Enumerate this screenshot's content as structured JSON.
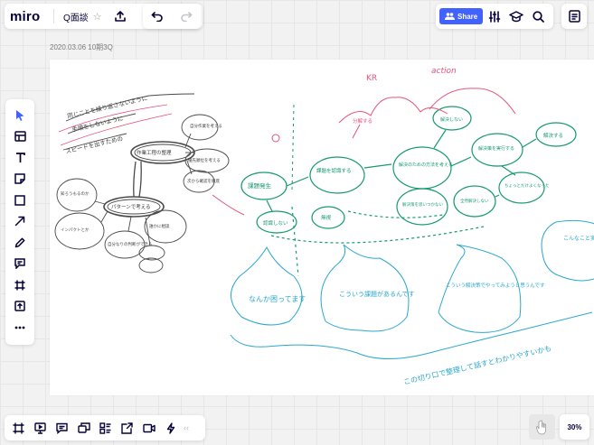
{
  "app": {
    "logo": "miro",
    "board_name": "Q面談",
    "zoom": "30%"
  },
  "header": {
    "share_label": "Share"
  },
  "frame": {
    "label": "2020.03.06 10期3Q"
  },
  "colors": {
    "accent": "#4262ff",
    "ink_black": "#333333",
    "ink_green": "#179a70",
    "ink_pink": "#e8527a",
    "ink_cyan": "#2aa8cf"
  },
  "board": {
    "black_notes": {
      "header_1": "同じことを繰り返さないように",
      "header_2": "手順をしないように",
      "header_3": "スピードを出すための"
    },
    "black_nodes": [
      "作業工程の整理",
      "自分作業を考える",
      "優先順位を考える",
      "次から確認を徹底",
      "知ろうもるのか",
      "パターンで考える",
      "インパクトとか",
      "自分なりの判断ができる",
      "誰かに相談"
    ],
    "green_nodes": [
      "課題発生",
      "認識しない",
      "課題を認識する",
      "無視",
      "解決のための方法を考える",
      "解決しない",
      "解決策を実行する",
      "解決する",
      "解決策を思いつかない",
      "全然解決しない",
      "ちょっとだけよくなった"
    ],
    "pink_labels": {
      "kr": "KR",
      "action": "action",
      "breakdown": "分解する"
    },
    "cyan_notes": {
      "bubble_1": "なんか困ってます",
      "bubble_2": "こういう課題があるんです",
      "bubble_3": "こういう解決策でやってみようと思うんです",
      "bubble_4": "こんなこと実行",
      "bottom_line": "この切り口で整理して話すとわかりやすいかも"
    }
  }
}
